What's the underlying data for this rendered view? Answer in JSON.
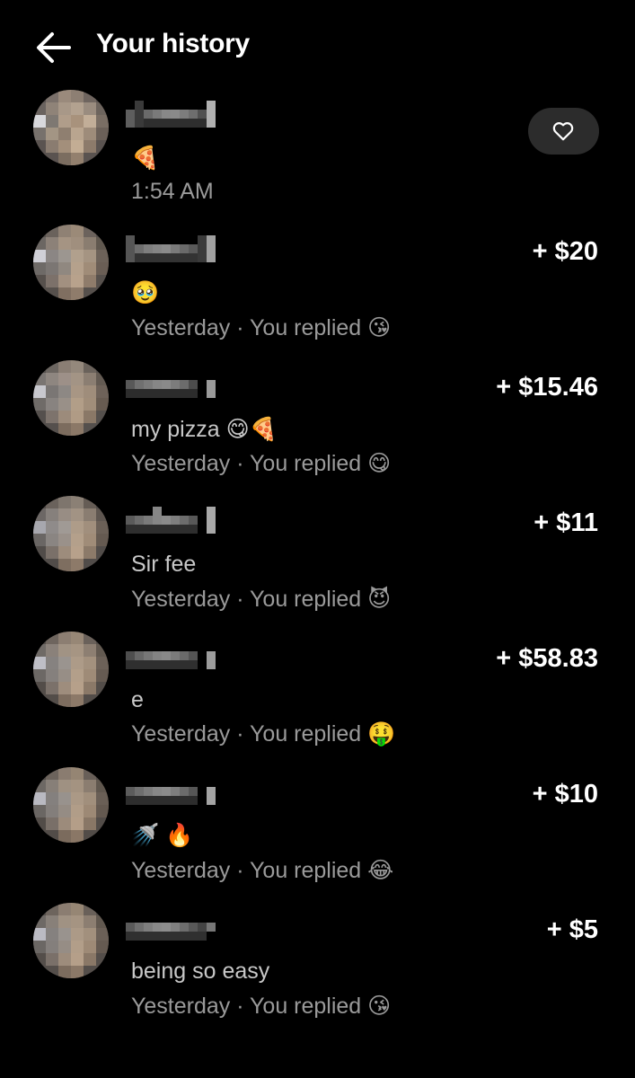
{
  "header": {
    "title": "Your history"
  },
  "items": [
    {
      "message": "🍕",
      "meta": "1:54 AM",
      "amount": ""
    },
    {
      "message": "🥹",
      "meta": "Yesterday · You replied 😘",
      "amount": "+ $20"
    },
    {
      "message": "my pizza 😋🍕",
      "meta": "Yesterday · You replied 😋",
      "amount": "+ $15.46"
    },
    {
      "message": "Sir fee",
      "meta": "Yesterday · You replied 😈",
      "amount": "+ $11"
    },
    {
      "message": "e",
      "meta": "Yesterday · You replied 🤑",
      "amount": "+ $58.83"
    },
    {
      "message": "🚿 🔥",
      "meta": "Yesterday · You replied 😂",
      "amount": "+ $10"
    },
    {
      "message": "being so easy",
      "meta": "Yesterday · You replied 😘",
      "amount": "+ $5"
    }
  ],
  "icons": {
    "back": "arrow-left-icon",
    "like": "heart-icon"
  },
  "colors": {
    "background": "#000000",
    "text_primary": "#ffffff",
    "text_secondary": "#9a9a9a",
    "button_bg": "#2c2c2c"
  }
}
